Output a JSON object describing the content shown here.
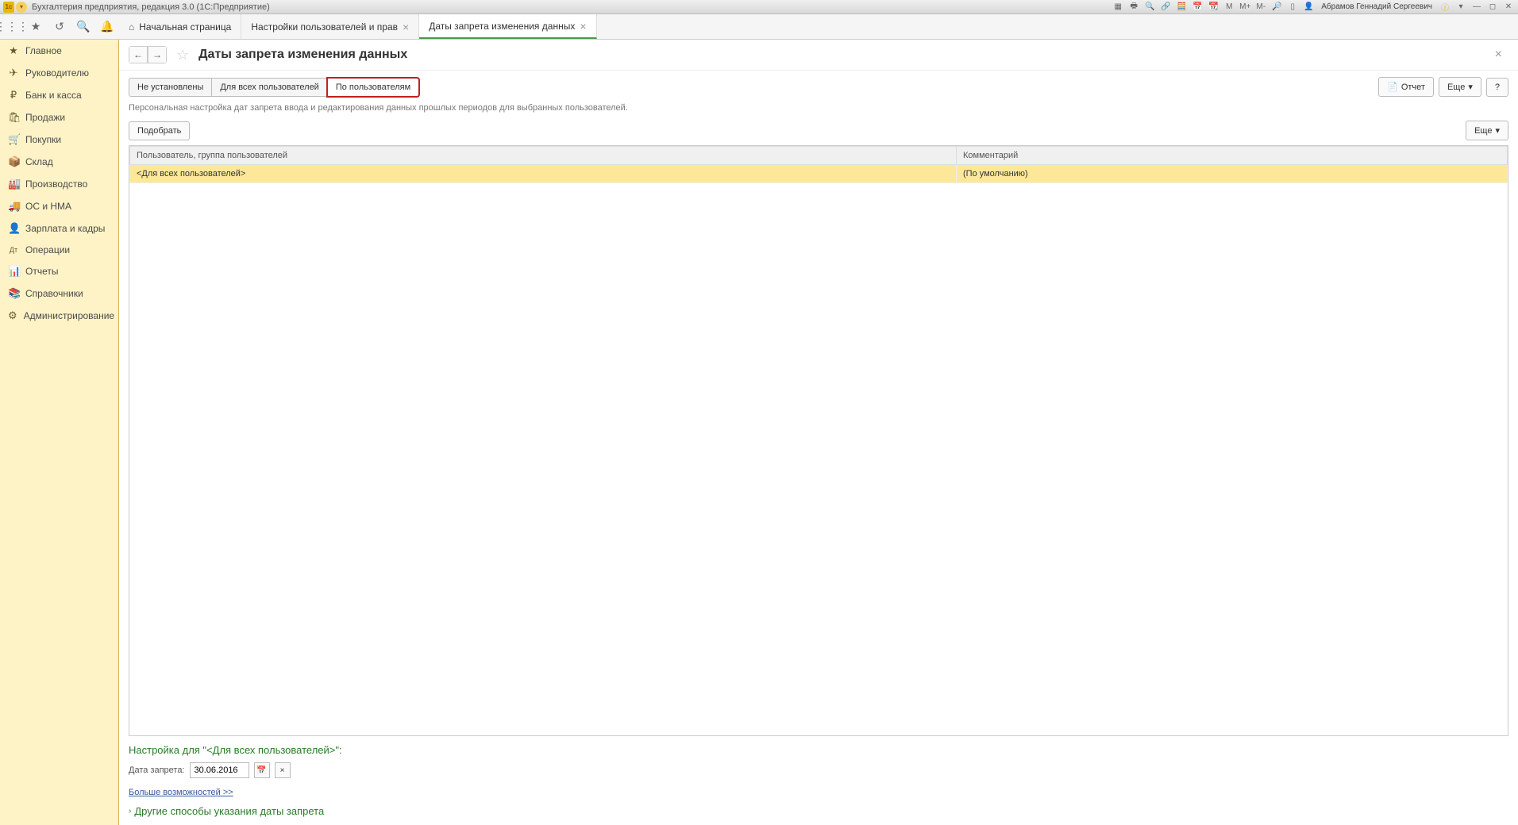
{
  "titlebar": {
    "app_title": "Бухгалтерия предприятия, редакция 3.0  (1С:Предприятие)",
    "user": "Абрамов Геннадий Сергеевич",
    "mem_labels": [
      "M",
      "M+",
      "M-"
    ]
  },
  "tabs": [
    {
      "label": "Начальная страница",
      "home": true,
      "active": false,
      "closable": false
    },
    {
      "label": "Настройки пользователей и прав",
      "home": false,
      "active": false,
      "closable": true
    },
    {
      "label": "Даты запрета изменения данных",
      "home": false,
      "active": true,
      "closable": true
    }
  ],
  "sidebar": [
    {
      "icon": "★",
      "label": "Главное"
    },
    {
      "icon": "✈",
      "label": "Руководителю"
    },
    {
      "icon": "₽",
      "label": "Банк и касса"
    },
    {
      "icon": "🛍",
      "label": "Продажи"
    },
    {
      "icon": "🛒",
      "label": "Покупки"
    },
    {
      "icon": "📦",
      "label": "Склад"
    },
    {
      "icon": "🏭",
      "label": "Производство"
    },
    {
      "icon": "🚚",
      "label": "ОС и НМА"
    },
    {
      "icon": "👤",
      "label": "Зарплата и кадры"
    },
    {
      "icon": "Дт",
      "label": "Операции"
    },
    {
      "icon": "📊",
      "label": "Отчеты"
    },
    {
      "icon": "📚",
      "label": "Справочники"
    },
    {
      "icon": "⚙",
      "label": "Администрирование"
    }
  ],
  "page": {
    "title": "Даты запрета изменения данных",
    "modes": [
      {
        "label": "Не установлены"
      },
      {
        "label": "Для всех пользователей"
      },
      {
        "label": "По пользователям"
      }
    ],
    "report_btn": "Отчет",
    "more_btn": "Еще",
    "help_btn": "?",
    "description": "Персональная настройка дат запрета ввода и редактирования данных прошлых периодов для выбранных пользователей.",
    "select_btn": "Подобрать",
    "table_more_btn": "Еще",
    "table": {
      "col_user": "Пользователь, группа пользователей",
      "col_comment": "Комментарий",
      "rows": [
        {
          "user": "<Для всех пользователей>",
          "comment": "(По умолчанию)"
        }
      ]
    },
    "setting_title": "Настройка для \"<Для всех пользователей>\":",
    "date_label": "Дата запрета:",
    "date_value": "30.06.2016",
    "more_link": "Больше возможностей >>",
    "expand_title": "Другие способы указания даты запрета"
  }
}
